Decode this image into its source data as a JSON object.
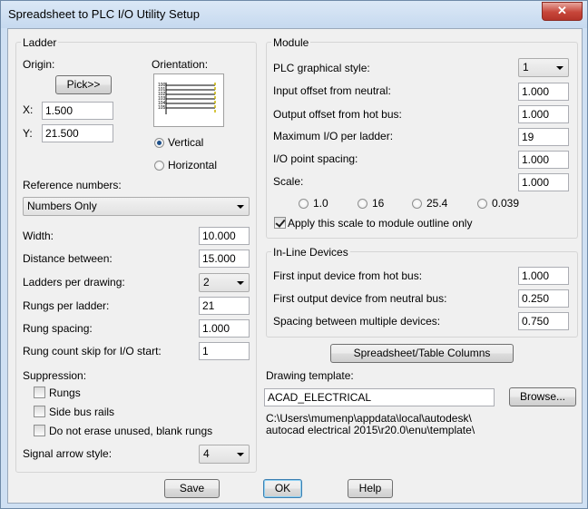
{
  "window": {
    "title": "Spreadsheet to PLC I/O Utility Setup",
    "close_glyph": "✕"
  },
  "ladder": {
    "group_title": "Ladder",
    "origin_label": "Origin:",
    "pick_button": "Pick>>",
    "x_label": "X:",
    "x_value": "1.500",
    "y_label": "Y:",
    "y_value": "21.500",
    "orientation_label": "Orientation:",
    "vertical_label": "Vertical",
    "horizontal_label": "Horizontal",
    "orientation_selected": "Vertical",
    "reference_numbers_label": "Reference numbers:",
    "reference_numbers_value": "Numbers Only",
    "width_label": "Width:",
    "width_value": "10.000",
    "distance_label": "Distance between:",
    "distance_value": "15.000",
    "ladders_per_drawing_label": "Ladders per drawing:",
    "ladders_per_drawing_value": "2",
    "rungs_per_ladder_label": "Rungs per ladder:",
    "rungs_per_ladder_value": "21",
    "rung_spacing_label": "Rung spacing:",
    "rung_spacing_value": "1.000",
    "rung_skip_label": "Rung count skip for I/O start:",
    "rung_skip_value": "1",
    "suppression_label": "Suppression:",
    "suppress_rungs_label": "Rungs",
    "suppress_rungs_checked": false,
    "suppress_side_rails_label": "Side bus rails",
    "suppress_side_rails_checked": false,
    "no_erase_label": "Do not erase unused, blank rungs",
    "no_erase_checked": false,
    "signal_arrow_label": "Signal arrow style:",
    "signal_arrow_value": "4"
  },
  "module": {
    "group_title": "Module",
    "plc_style_label": "PLC graphical style:",
    "plc_style_value": "1",
    "input_offset_label": "Input offset from neutral:",
    "input_offset_value": "1.000",
    "output_offset_label": "Output offset from hot bus:",
    "output_offset_value": "1.000",
    "max_io_label": "Maximum I/O per ladder:",
    "max_io_value": "19",
    "io_spacing_label": "I/O point spacing:",
    "io_spacing_value": "1.000",
    "scale_label": "Scale:",
    "scale_value": "1.000",
    "scale_options": [
      "1.0",
      "16",
      "25.4",
      "0.039"
    ],
    "apply_scale_label": "Apply this scale to module outline only",
    "apply_scale_checked": true
  },
  "inline": {
    "group_title": "In-Line Devices",
    "first_input_label": "First input device from hot bus:",
    "first_input_value": "1.000",
    "first_output_label": "First output device from neutral bus:",
    "first_output_value": "0.250",
    "spacing_label": "Spacing between multiple devices:",
    "spacing_value": "0.750"
  },
  "template": {
    "columns_button": "Spreadsheet/Table Columns",
    "drawing_template_label": "Drawing template:",
    "template_value": "ACAD_ELECTRICAL",
    "browse_button": "Browse...",
    "path_line1": "C:\\Users\\mumenp\\appdata\\local\\autodesk\\",
    "path_line2": "autocad electrical 2015\\r20.0\\enu\\template\\"
  },
  "footer": {
    "save_button": "Save",
    "ok_button": "OK",
    "help_button": "Help"
  },
  "colors": {
    "accent": "#1c4f8a",
    "preview_rung_label": "#000000",
    "preview_rail": "#c8b400"
  }
}
